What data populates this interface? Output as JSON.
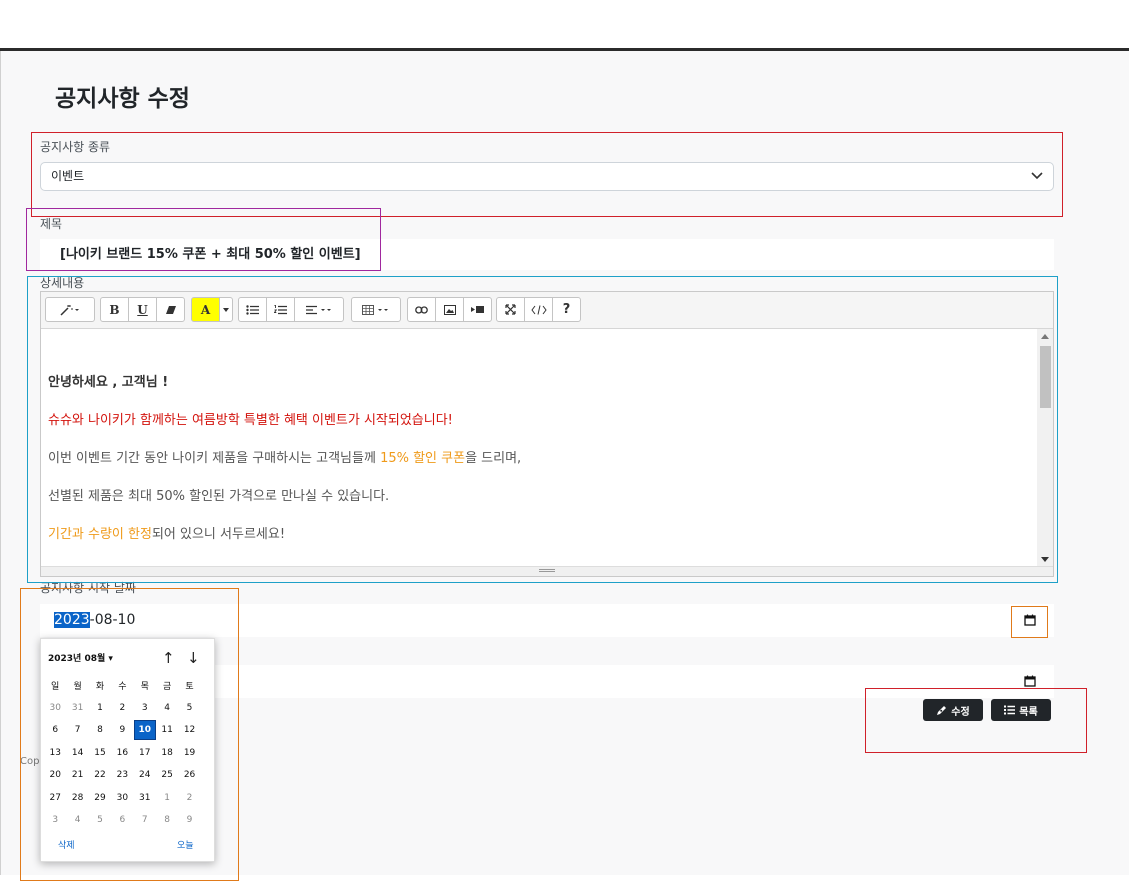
{
  "page_title": "공지사항 수정",
  "notice_type": {
    "label": "공지사항 종류",
    "value": "이벤트"
  },
  "subject": {
    "label": "제목",
    "value": "[나이키 브랜드 15% 쿠폰 + 최대 50% 할인 이벤트]"
  },
  "details": {
    "label": "상세내용",
    "toolbar": [
      "magic-icon",
      "bold-icon",
      "underline-icon",
      "eraser-icon",
      "font-color-icon",
      "color-dropdown-icon",
      "unordered-list-icon",
      "ordered-list-icon",
      "align-icon",
      "table-icon",
      "link-icon",
      "picture-icon",
      "video-icon",
      "fullscreen-icon",
      "code-view-icon",
      "help-icon"
    ],
    "toolbar_text": {
      "bold": "B",
      "underline": "U",
      "color": "A",
      "help": "?"
    },
    "lines": {
      "l1": "안녕하세요 , 고객님 !",
      "l2": "슈슈와 나이키가 함께하는 여름방학 특별한 혜택 이벤트가 시작되었습니다!",
      "l3a": "이번 이벤트 기간 동안 나이키 제품을 구매하시는 고객님들께 ",
      "l3b": "15% 할인 쿠폰",
      "l3c": "을 드리며,",
      "l4": "선별된 제품은 최대 50% 할인된 가격으로 만나실 수 있습니다.",
      "l5a": "기간과 수량이 한정",
      "l5b": "되어 있으니 서두르세요!"
    }
  },
  "start_date": {
    "label": "공지사항 시작 날짜",
    "year": "2023",
    "rest": "-08-10"
  },
  "datepicker": {
    "header": "2023년 08월",
    "weekdays": [
      "일",
      "월",
      "화",
      "수",
      "목",
      "금",
      "토"
    ],
    "weeks": [
      [
        "30",
        "31",
        "1",
        "2",
        "3",
        "4",
        "5"
      ],
      [
        "6",
        "7",
        "8",
        "9",
        "10",
        "11",
        "12"
      ],
      [
        "13",
        "14",
        "15",
        "16",
        "17",
        "18",
        "19"
      ],
      [
        "20",
        "21",
        "22",
        "23",
        "24",
        "25",
        "26"
      ],
      [
        "27",
        "28",
        "29",
        "30",
        "31",
        "1",
        "2"
      ],
      [
        "3",
        "4",
        "5",
        "6",
        "7",
        "8",
        "9"
      ]
    ],
    "selected": "10",
    "clear_label": "삭제",
    "today_label": "오늘"
  },
  "buttons": {
    "edit": "수정",
    "list": "목록"
  },
  "footer_fragment": "Cop",
  "colors": {
    "dark_button": "#212529",
    "accent_blue": "#0a64c8",
    "text_red": "#d3130d",
    "text_orange": "#ef9a1a",
    "annotation_red": "#d0202a",
    "annotation_purple": "#a0289e",
    "annotation_cyan": "#1ea0c8",
    "annotation_orange": "#e07a1a"
  }
}
